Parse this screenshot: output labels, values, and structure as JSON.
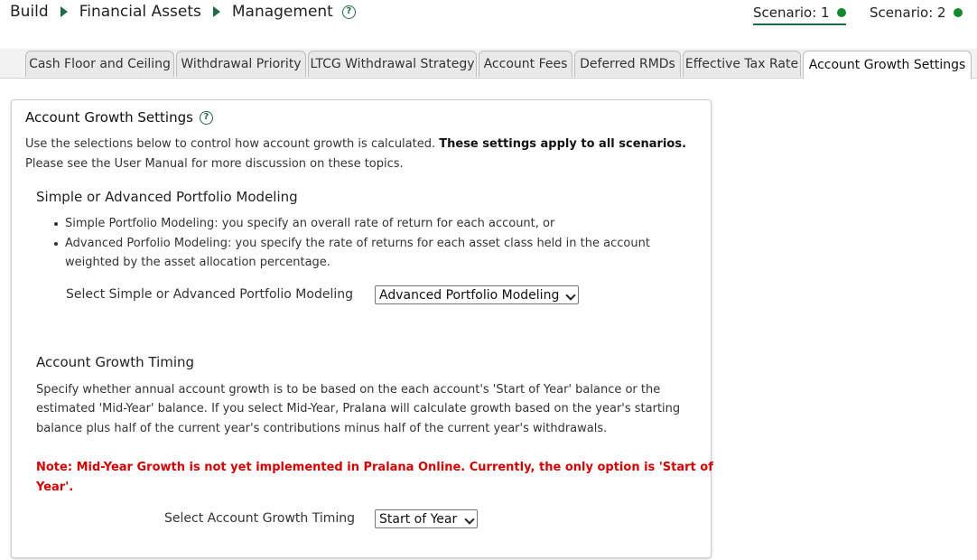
{
  "breadcrumb": [
    "Build",
    "Financial Assets",
    "Management"
  ],
  "scenarios": [
    {
      "label": "Scenario: 1",
      "status_color": "#118a2e"
    },
    {
      "label": "Scenario: 2",
      "status_color": "#118a2e"
    }
  ],
  "tabs": [
    "Cash Floor and Ceiling",
    "Withdrawal Priority",
    "LTCG Withdrawal Strategy",
    "Account Fees",
    "Deferred RMDs",
    "Effective Tax Rate",
    "Account Growth Settings"
  ],
  "active_tab": "Account Growth Settings",
  "panel": {
    "title": "Account Growth Settings",
    "intro_plain": "Use the selections below to control how account growth is calculated. ",
    "intro_bold": "These settings apply to all scenarios.",
    "intro_line2": "Please see the User Manual for more discussion on these topics.",
    "modeling": {
      "heading": "Simple or Advanced Portfolio Modeling",
      "bullet1": "Simple Portfolio Modeling: you specify an overall rate of return for each account, or",
      "bullet2_line1": "Advanced Porfolio Modeling: you specify the rate of returns for each asset class held in the account",
      "bullet2_line2": "weighted by the asset allocation percentage.",
      "select_label": "Select Simple or Advanced Portfolio Modeling",
      "select_value": "Advanced Portfolio Modeling"
    },
    "timing": {
      "heading": "Account Growth Timing",
      "desc_line1": "Specify whether annual account growth is to be based on the each account's 'Start of Year' balance or the",
      "desc_line2": "estimated 'Mid-Year' balance. If you select Mid-Year, Pralana will calculate growth based on the year's starting",
      "desc_line3": "balance plus half of the current year's contributions minus half of the current year's withdrawals.",
      "note_line1": "Note: Mid-Year Growth is not yet implemented in Pralana Online. Currently, the only option is 'Start of",
      "note_line2": "Year'.",
      "select_label": "Select Account Growth Timing",
      "select_value": "Start of Year"
    }
  }
}
